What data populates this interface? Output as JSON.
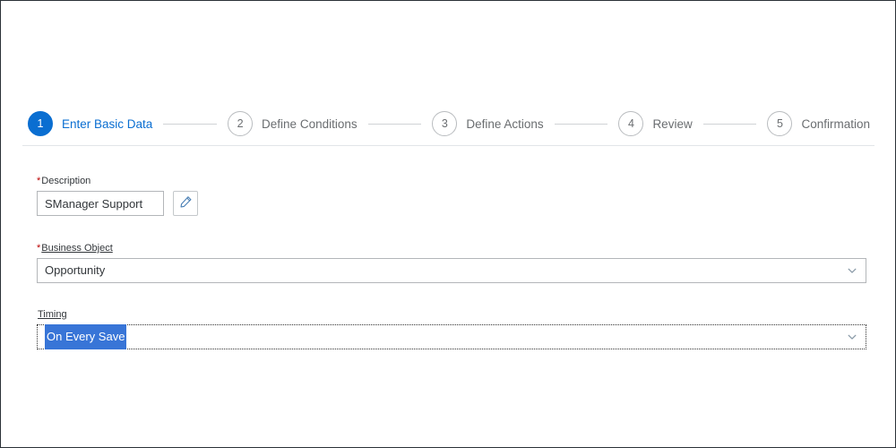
{
  "wizard": {
    "steps": [
      {
        "number": "1",
        "label": "Enter Basic Data",
        "state": "active"
      },
      {
        "number": "2",
        "label": "Define Conditions",
        "state": "inactive"
      },
      {
        "number": "3",
        "label": "Define Actions",
        "state": "inactive"
      },
      {
        "number": "4",
        "label": "Review",
        "state": "inactive"
      },
      {
        "number": "5",
        "label": "Confirmation",
        "state": "inactive"
      }
    ],
    "active_color": "#0a6ed1",
    "inactive_color": "#6a6d70"
  },
  "form": {
    "description": {
      "required_marker": "*",
      "label": "Description",
      "value": "SManager Support",
      "placeholder": "",
      "edit_button_icon": "pencil-icon"
    },
    "business_object": {
      "required_marker": "*",
      "label": "Business Object",
      "value": "Opportunity",
      "dropdown_icon": "chevron-down-icon"
    },
    "timing": {
      "required_marker": "",
      "label": "Timing",
      "value": "On Every Save",
      "dropdown_icon": "chevron-down-icon",
      "selected": true,
      "focused": true,
      "selection_color": "#3875d7"
    }
  }
}
